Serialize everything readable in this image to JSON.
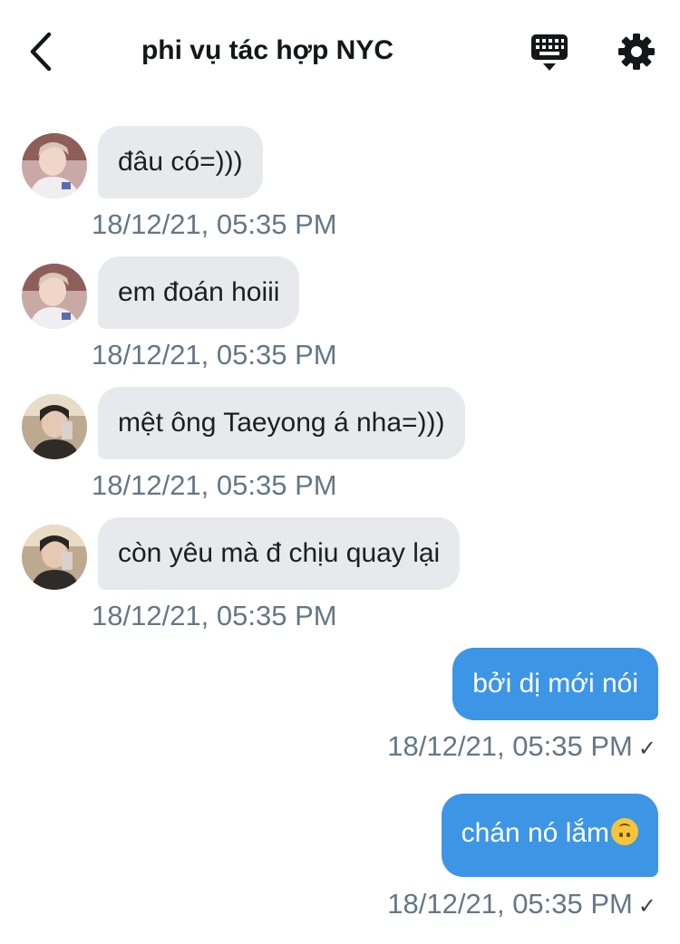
{
  "header": {
    "title": "phi vụ tác hợp NYC",
    "back_icon": "chevron-left-icon",
    "keyboard_icon": "keyboard-icon",
    "settings_icon": "gear-icon"
  },
  "colors": {
    "incoming_bubble": "#e7e9ed",
    "outgoing_bubble": "#3d95e6",
    "timestamp": "#657786"
  },
  "messages": [
    {
      "direction": "incoming",
      "text": "đâu có=)))",
      "timestamp": "18/12/21, 05:35 PM",
      "avatar": "avatar-1"
    },
    {
      "direction": "incoming",
      "text": "em đoán hoiii",
      "timestamp": "18/12/21, 05:35 PM",
      "avatar": "avatar-1"
    },
    {
      "direction": "incoming",
      "text": "mệt ông Taeyong á nha=)))",
      "timestamp": "18/12/21, 05:35 PM",
      "avatar": "avatar-2"
    },
    {
      "direction": "incoming",
      "text": "còn yêu mà đ chịu quay lại",
      "timestamp": "18/12/21, 05:35 PM",
      "avatar": "avatar-2"
    },
    {
      "direction": "outgoing",
      "text": "bởi dị mới nói",
      "timestamp": "18/12/21, 05:35 PM",
      "status": "✓"
    },
    {
      "direction": "outgoing",
      "text": "chán nó lắm",
      "emoji": "upside-down-face-emoji",
      "timestamp": "18/12/21, 05:35 PM",
      "status": "✓"
    }
  ]
}
